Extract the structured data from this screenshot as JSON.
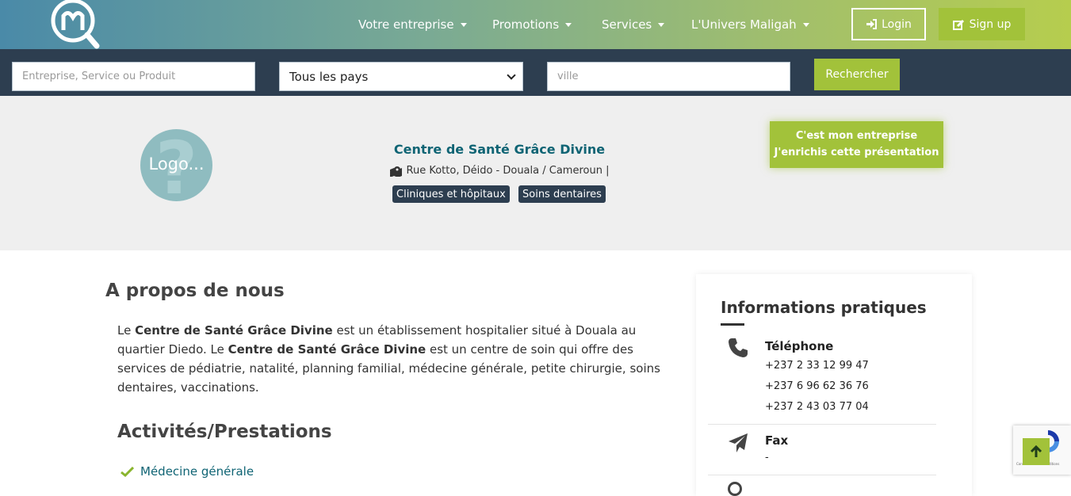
{
  "brand": {
    "logo_icon": "maligah-logo-magnifier"
  },
  "nav": {
    "items": [
      {
        "label": "Votre entreprise"
      },
      {
        "label": "Promotions"
      },
      {
        "label": "Services"
      },
      {
        "label": "L'Univers Maligah"
      }
    ],
    "login_label": "Login",
    "signup_label": "Sign up"
  },
  "search": {
    "query_placeholder": "Entreprise, Service ou Produit",
    "country_selected": "Tous les pays",
    "city_placeholder": "ville",
    "button_label": "Rechercher"
  },
  "company": {
    "logo_placeholder": "Logo...",
    "name": "Centre de Santé Grâce Divine",
    "address": "Rue Kotto, Déido - Douala / Cameroun |",
    "tags": [
      "Cliniques et hôpitaux",
      "Soins dentaires"
    ],
    "claim_line1": "C'est mon entreprise",
    "claim_line2": "J'enrichis cette présentation"
  },
  "about": {
    "title": "A propos de nous",
    "p_prefix": "Le ",
    "p_name1": "Centre de Santé Grâce Divine",
    "p_mid": " est un établissement hospitalier situé à Douala au quartier Diedo. Le ",
    "p_name2": "Centre de Santé Grâce Divine",
    "p_suffix": " est un centre de soin qui offre des services de pédiatrie, natalité, planning familial, médecine générale, petite chirurgie, soins dentaires, vaccinations."
  },
  "activities": {
    "title": "Activités/Prestations",
    "items": [
      "Médecine générale"
    ]
  },
  "info": {
    "title": "Informations pratiques",
    "phone_label": "Téléphone",
    "phones": [
      "+237 2 33 12 99 47",
      "+237 6 96 62 36 76",
      "+237 2 43 03 77 04"
    ],
    "fax_label": "Fax",
    "fax_value": "-"
  },
  "recaptcha": {
    "text": "Confidentialité - Conditions"
  },
  "colors": {
    "accent": "#a2c23a",
    "dark": "#2d3e50",
    "teal": "#0f6474"
  }
}
